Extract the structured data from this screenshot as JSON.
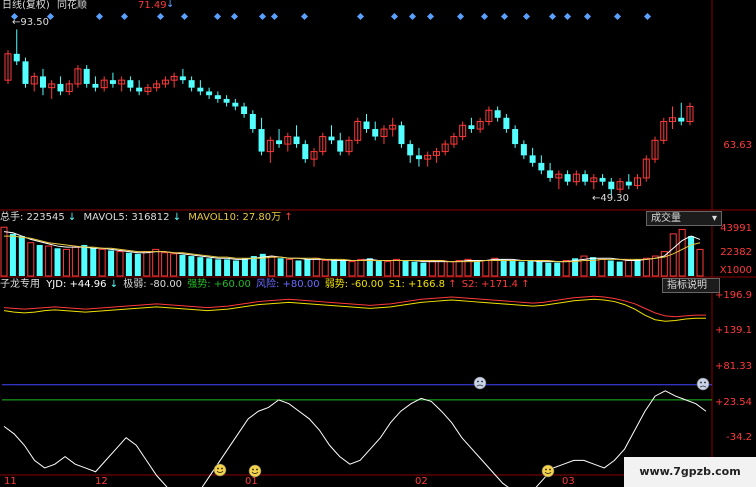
{
  "colors": {
    "up": "#ff3a3a",
    "down": "#54ffff",
    "white": "#ffffff",
    "yellow": "#f0e000",
    "green": "#22bb22",
    "blue": "#4444ff",
    "grid": "#8b0000",
    "diamond": "#5aa0ff",
    "mavol10": "#e8c840"
  },
  "price_panel": {
    "title": "日线(复权)",
    "source": "同花顺",
    "marker_value": "71.49",
    "high_label": "93.50",
    "low_label": "49.30",
    "right_label": "63.63"
  },
  "volume_panel": {
    "vol_label": "总手: 223545",
    "mavol5_label": "MAVOL5: 316812",
    "mavol10_label": "MAVOL10: 27.80万",
    "button": "成交量",
    "axis": [
      "43991",
      "22382",
      "X1000"
    ]
  },
  "indicator_panel": {
    "name": "子龙专用",
    "yjd": "YJD: +44.96",
    "jiruo": "极弱: -80.00",
    "qiangshi": "强势: +60.00",
    "fengxian": "风险: +80.00",
    "ruoshi": "弱势: -60.00",
    "s1": "S1: +166.8",
    "s2": "S2: +171.4",
    "button": "指标说明",
    "axis": [
      "+196.9",
      "+139.1",
      "+81.33",
      "+23.54",
      "-34.2"
    ]
  },
  "time_axis": [
    "11",
    "12",
    "01",
    "02",
    "03"
  ],
  "watermark": "www.7gpzb.com",
  "chart_data": [
    {
      "type": "candlestick",
      "title": "日线(复权)",
      "y_labels": [
        93.5,
        63.63,
        49.3
      ],
      "ohlc": [
        [
          80,
          88,
          79,
          87
        ],
        [
          87,
          93.5,
          84,
          85
        ],
        [
          85,
          86,
          78,
          79
        ],
        [
          79,
          82,
          77,
          81
        ],
        [
          81,
          83,
          76,
          78
        ],
        [
          78,
          80,
          75,
          79
        ],
        [
          79,
          81,
          76,
          77
        ],
        [
          77,
          80,
          76,
          79
        ],
        [
          79,
          84,
          78,
          83
        ],
        [
          83,
          84,
          78,
          79
        ],
        [
          79,
          81,
          77,
          78
        ],
        [
          78,
          81,
          77,
          80
        ],
        [
          80,
          82,
          78,
          79
        ],
        [
          79,
          81,
          77,
          80
        ],
        [
          80,
          81,
          77,
          78
        ],
        [
          78,
          80,
          76,
          77
        ],
        [
          77,
          79,
          76,
          78
        ],
        [
          78,
          80,
          77,
          79
        ],
        [
          79,
          81,
          78,
          80
        ],
        [
          80,
          82,
          78,
          81
        ],
        [
          81,
          83,
          79,
          80
        ],
        [
          80,
          81,
          77,
          78
        ],
        [
          78,
          80,
          76,
          77
        ],
        [
          77,
          78,
          75,
          76
        ],
        [
          76,
          77,
          74,
          75
        ],
        [
          75,
          76,
          73,
          74
        ],
        [
          74,
          75,
          72,
          73
        ],
        [
          73,
          74,
          70,
          71
        ],
        [
          71,
          72,
          66,
          67
        ],
        [
          67,
          70,
          60,
          61
        ],
        [
          61,
          65,
          58,
          64
        ],
        [
          64,
          67,
          62,
          63
        ],
        [
          63,
          66,
          61,
          65
        ],
        [
          65,
          68,
          62,
          63
        ],
        [
          63,
          64,
          58,
          59
        ],
        [
          59,
          62,
          57,
          61
        ],
        [
          61,
          66,
          60,
          65
        ],
        [
          65,
          68,
          63,
          64
        ],
        [
          64,
          66,
          60,
          61
        ],
        [
          61,
          65,
          60,
          64
        ],
        [
          64,
          70,
          63,
          69
        ],
        [
          69,
          71,
          66,
          67
        ],
        [
          67,
          69,
          64,
          65
        ],
        [
          65,
          68,
          63,
          67
        ],
        [
          67,
          70,
          65,
          68
        ],
        [
          68,
          69,
          62,
          63
        ],
        [
          63,
          64,
          58,
          60
        ],
        [
          60,
          62,
          57,
          59
        ],
        [
          59,
          61,
          57,
          60
        ],
        [
          60,
          62,
          58,
          61
        ],
        [
          61,
          64,
          60,
          63
        ],
        [
          63,
          66,
          62,
          65
        ],
        [
          65,
          69,
          64,
          68
        ],
        [
          68,
          70,
          66,
          67
        ],
        [
          67,
          70,
          66,
          69
        ],
        [
          69,
          73,
          68,
          72
        ],
        [
          72,
          73,
          69,
          70
        ],
        [
          70,
          71,
          66,
          67
        ],
        [
          67,
          68,
          62,
          63
        ],
        [
          63,
          64,
          59,
          60
        ],
        [
          60,
          62,
          57,
          58
        ],
        [
          58,
          60,
          55,
          56
        ],
        [
          56,
          58,
          53,
          54
        ],
        [
          54,
          56,
          51,
          55
        ],
        [
          55,
          56,
          52,
          53
        ],
        [
          53,
          56,
          52,
          55
        ],
        [
          55,
          56,
          52,
          53
        ],
        [
          53,
          55,
          51,
          54
        ],
        [
          54,
          55,
          52,
          53
        ],
        [
          53,
          54,
          49.3,
          51
        ],
        [
          51,
          54,
          50,
          53
        ],
        [
          53,
          55,
          51,
          52
        ],
        [
          52,
          55,
          51,
          54
        ],
        [
          54,
          60,
          53,
          59
        ],
        [
          59,
          65,
          58,
          64
        ],
        [
          64,
          70,
          63,
          69
        ],
        [
          69,
          73,
          67,
          70
        ],
        [
          70,
          74,
          68,
          69
        ],
        [
          69,
          74,
          68,
          73
        ]
      ]
    },
    {
      "type": "bar",
      "title": "成交量",
      "series": [
        {
          "name": "总手",
          "values": [
            44,
            38,
            36,
            30,
            28,
            27,
            25,
            24,
            26,
            28,
            25,
            24,
            23,
            22,
            21,
            20,
            22,
            24,
            21,
            20,
            19,
            18,
            17,
            16,
            15,
            15,
            14,
            16,
            18,
            20,
            17,
            16,
            15,
            14,
            15,
            16,
            14,
            15,
            14,
            13,
            15,
            16,
            14,
            13,
            15,
            14,
            13,
            12,
            13,
            14,
            13,
            14,
            15,
            13,
            14,
            16,
            15,
            14,
            13,
            14,
            13,
            12,
            12,
            14,
            16,
            18,
            17,
            15,
            14,
            13,
            14,
            15,
            16,
            18,
            22,
            38,
            42,
            36,
            24
          ]
        },
        {
          "name": "MAVOL5",
          "values": [
            40,
            39,
            36,
            33,
            31,
            29,
            27,
            26,
            26,
            26,
            25,
            25,
            24,
            23,
            22,
            21,
            21,
            22,
            22,
            21,
            20,
            19,
            18,
            17,
            16,
            16,
            15,
            15,
            16,
            17,
            18,
            17,
            16,
            16,
            15,
            15,
            15,
            14,
            14,
            14,
            14,
            15,
            14,
            14,
            14,
            14,
            14,
            13,
            13,
            13,
            13,
            13,
            14,
            14,
            14,
            15,
            15,
            15,
            14,
            14,
            13,
            13,
            13,
            13,
            14,
            15,
            16,
            16,
            16,
            15,
            14,
            14,
            15,
            16,
            18,
            25,
            32,
            36,
            33
          ]
        },
        {
          "name": "MAVOL10",
          "values": [
            36,
            36,
            35,
            34,
            32,
            30,
            29,
            28,
            27,
            26,
            26,
            25,
            25,
            24,
            23,
            22,
            22,
            22,
            22,
            21,
            21,
            20,
            19,
            18,
            17,
            17,
            16,
            16,
            16,
            16,
            17,
            17,
            16,
            16,
            16,
            16,
            15,
            15,
            15,
            14,
            14,
            14,
            14,
            14,
            14,
            14,
            14,
            14,
            14,
            14,
            13,
            13,
            13,
            13,
            14,
            14,
            14,
            14,
            14,
            14,
            14,
            14,
            13,
            13,
            13,
            14,
            14,
            15,
            15,
            15,
            15,
            15,
            15,
            16,
            17,
            20,
            24,
            28,
            30
          ]
        }
      ],
      "y_labels": [
        43991,
        22382
      ]
    },
    {
      "type": "line",
      "title": "子龙专用",
      "y_labels": [
        196.9,
        139.1,
        81.33,
        23.54,
        -34.2
      ],
      "series": [
        {
          "name": "YJD",
          "values": [
            25,
            15,
            0,
            -20,
            -30,
            -25,
            -15,
            -25,
            -30,
            -35,
            -20,
            -5,
            10,
            0,
            -20,
            -40,
            -55,
            -70,
            -75,
            -65,
            -45,
            -25,
            -5,
            15,
            35,
            45,
            50,
            60,
            55,
            45,
            35,
            20,
            0,
            -15,
            -25,
            -20,
            -5,
            10,
            30,
            45,
            55,
            62,
            58,
            45,
            30,
            10,
            -5,
            -20,
            -35,
            -50,
            -60,
            -70,
            -60,
            -45,
            -30,
            -25,
            -20,
            -20,
            -25,
            -30,
            -20,
            -5,
            20,
            45,
            65,
            72,
            65,
            60,
            55,
            45
          ]
        },
        {
          "name": "S1",
          "values": [
            178,
            176,
            175,
            176,
            178,
            179,
            178,
            177,
            176,
            177,
            178,
            179,
            180,
            181,
            182,
            183,
            182,
            181,
            180,
            179,
            178,
            179,
            180,
            182,
            184,
            186,
            187,
            188,
            189,
            188,
            187,
            186,
            185,
            184,
            183,
            182,
            181,
            182,
            183,
            185,
            187,
            189,
            190,
            191,
            192,
            191,
            190,
            189,
            188,
            187,
            186,
            185,
            184,
            185,
            187,
            189,
            191,
            192,
            193,
            192,
            190,
            186,
            180,
            172,
            166,
            164,
            165,
            167,
            168,
            168
          ]
        },
        {
          "name": "S2",
          "values": [
            182,
            181,
            180,
            181,
            182,
            183,
            182,
            181,
            180,
            181,
            182,
            183,
            184,
            185,
            186,
            187,
            186,
            185,
            184,
            183,
            182,
            183,
            184,
            186,
            188,
            190,
            191,
            192,
            193,
            192,
            191,
            190,
            189,
            188,
            187,
            186,
            185,
            186,
            187,
            189,
            191,
            193,
            194,
            195,
            196,
            195,
            194,
            193,
            192,
            191,
            190,
            189,
            188,
            189,
            191,
            193,
            195,
            196,
            197,
            196,
            194,
            191,
            187,
            181,
            175,
            171,
            170,
            171,
            172,
            172
          ]
        }
      ],
      "reference_lines": [
        {
          "name": "风险",
          "value": 80
        },
        {
          "name": "强势",
          "value": 60
        },
        {
          "name": "弱势",
          "value": -60
        },
        {
          "name": "极弱",
          "value": -80
        }
      ]
    }
  ]
}
